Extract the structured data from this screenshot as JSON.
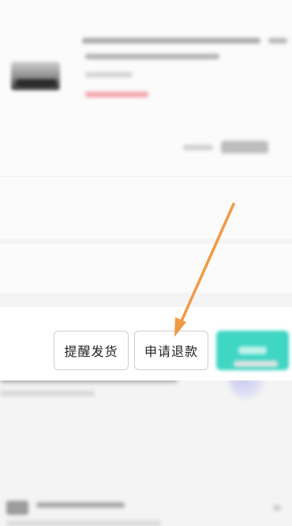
{
  "actions": {
    "remind_label": "提醒发货",
    "refund_label": "申请退款"
  },
  "colors": {
    "primary_button": "#3fd6c4",
    "price_text": "#f2a3a8",
    "annotation_arrow": "#f09a45"
  },
  "icons": {
    "annotation": "arrow-pointing-to-refund-button"
  }
}
